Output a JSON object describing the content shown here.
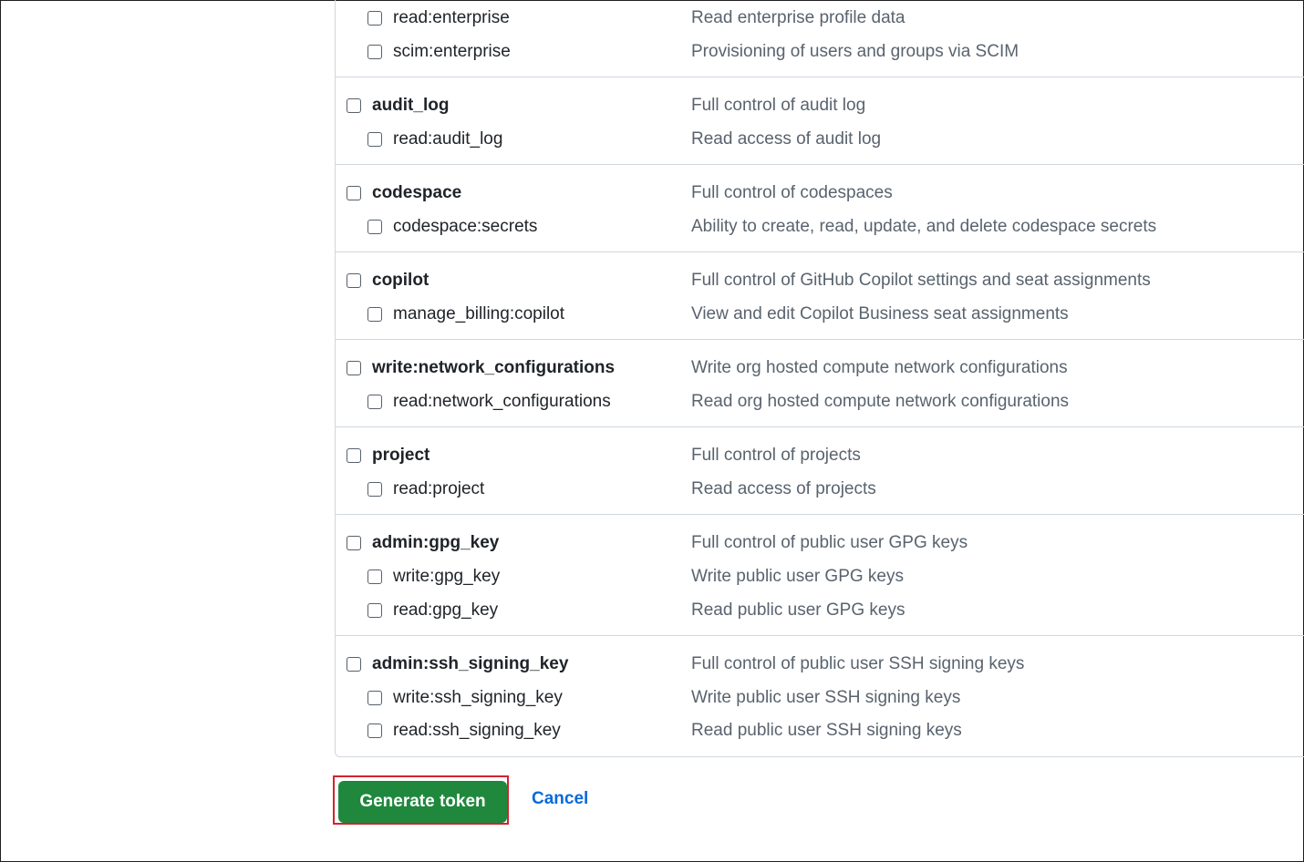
{
  "scopes": [
    {
      "children": [
        {
          "name": "read:enterprise",
          "description": "Read enterprise profile data",
          "checked": false
        },
        {
          "name": "scim:enterprise",
          "description": "Provisioning of users and groups via SCIM",
          "checked": false
        }
      ]
    },
    {
      "parent": {
        "name": "audit_log",
        "description": "Full control of audit log",
        "checked": false
      },
      "children": [
        {
          "name": "read:audit_log",
          "description": "Read access of audit log",
          "checked": false
        }
      ]
    },
    {
      "parent": {
        "name": "codespace",
        "description": "Full control of codespaces",
        "checked": false
      },
      "children": [
        {
          "name": "codespace:secrets",
          "description": "Ability to create, read, update, and delete codespace secrets",
          "checked": false
        }
      ]
    },
    {
      "parent": {
        "name": "copilot",
        "description": "Full control of GitHub Copilot settings and seat assignments",
        "checked": false
      },
      "children": [
        {
          "name": "manage_billing:copilot",
          "description": "View and edit Copilot Business seat assignments",
          "checked": false
        }
      ]
    },
    {
      "parent": {
        "name": "write:network_configurations",
        "description": "Write org hosted compute network configurations",
        "checked": false
      },
      "children": [
        {
          "name": "read:network_configurations",
          "description": "Read org hosted compute network configurations",
          "checked": false
        }
      ]
    },
    {
      "parent": {
        "name": "project",
        "description": "Full control of projects",
        "checked": false
      },
      "children": [
        {
          "name": "read:project",
          "description": "Read access of projects",
          "checked": false
        }
      ]
    },
    {
      "parent": {
        "name": "admin:gpg_key",
        "description": "Full control of public user GPG keys",
        "checked": false
      },
      "children": [
        {
          "name": "write:gpg_key",
          "description": "Write public user GPG keys",
          "checked": false
        },
        {
          "name": "read:gpg_key",
          "description": "Read public user GPG keys",
          "checked": false
        }
      ]
    },
    {
      "parent": {
        "name": "admin:ssh_signing_key",
        "description": "Full control of public user SSH signing keys",
        "checked": false
      },
      "children": [
        {
          "name": "write:ssh_signing_key",
          "description": "Write public user SSH signing keys",
          "checked": false
        },
        {
          "name": "read:ssh_signing_key",
          "description": "Read public user SSH signing keys",
          "checked": false
        }
      ]
    }
  ],
  "actions": {
    "generate_label": "Generate token",
    "cancel_label": "Cancel"
  },
  "colors": {
    "primary_button": "#1f883d",
    "highlight_outline": "#d1242f",
    "link": "#0969da"
  }
}
